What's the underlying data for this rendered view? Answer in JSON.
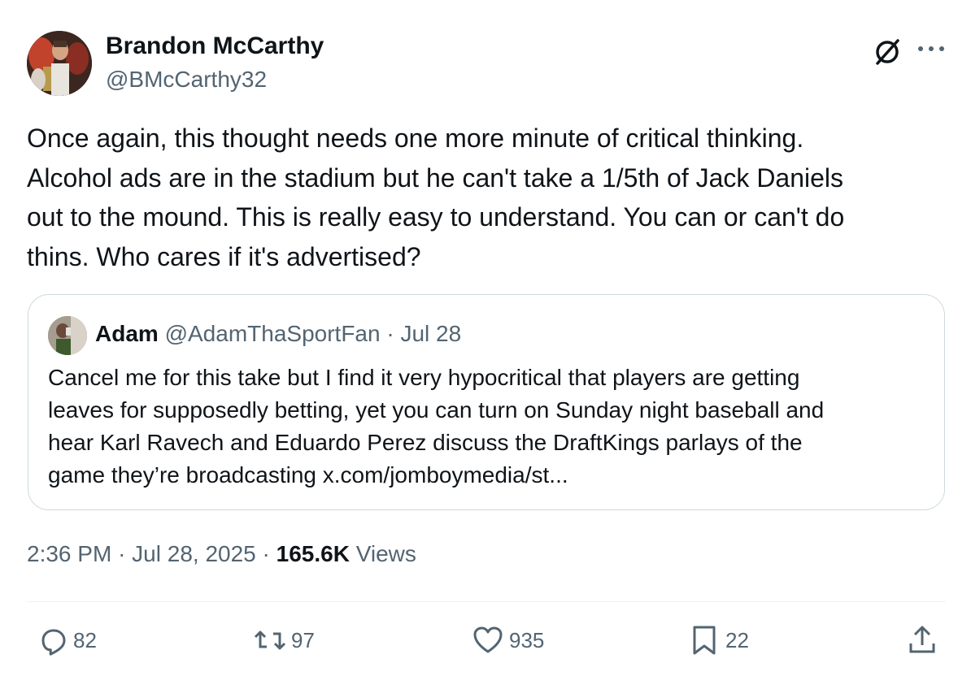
{
  "author": {
    "name": "Brandon McCarthy",
    "handle": "@BMcCarthy32"
  },
  "icons": {
    "grok": "grok-icon",
    "more": "more-icon",
    "reply": "reply-icon",
    "retweet": "retweet-icon",
    "like": "heart-icon",
    "bookmark": "bookmark-icon",
    "share": "share-icon"
  },
  "body": {
    "lines": [
      "Once again, this thought needs one more minute of critical thinking.",
      "Alcohol ads are in the stadium but he can't take a 1/5th of Jack Daniels",
      "out to the mound. This is really easy to understand. You can or can't do",
      "thins. Who cares if it's advertised?"
    ]
  },
  "quote": {
    "name": "Adam",
    "handle": "@AdamThaSportFan",
    "separator": "·",
    "date": "Jul 28",
    "lines": [
      "Cancel me for this take but I find it very hypocritical that players are getting",
      "leaves for supposedly betting, yet you can turn on Sunday night baseball and",
      "hear Karl Ravech and Eduardo Perez discuss the DraftKings parlays of the",
      "game they’re broadcasting x.com/jomboymedia/st..."
    ]
  },
  "meta": {
    "time": "2:36 PM",
    "sep1": "·",
    "date": "Jul 28, 2025",
    "sep2": "·",
    "views_count": "165.6K",
    "views_label": "Views"
  },
  "actions": {
    "replies": "82",
    "retweets": "97",
    "likes": "935",
    "bookmarks": "22"
  },
  "colors": {
    "text": "#0f1419",
    "secondary": "#536471",
    "border": "#cfd9de"
  }
}
